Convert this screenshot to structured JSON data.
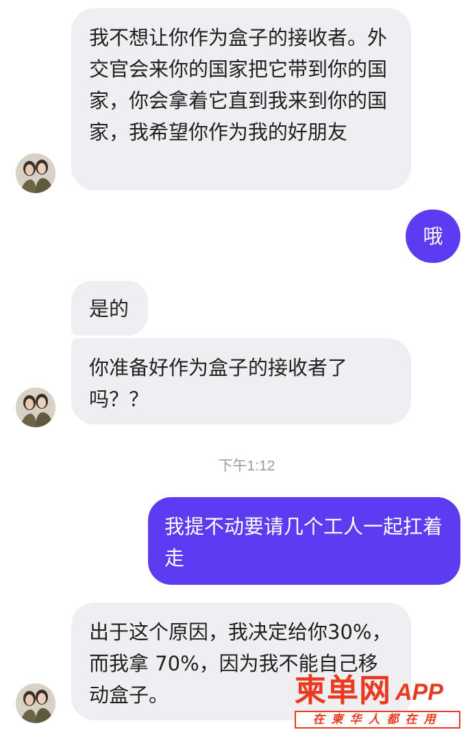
{
  "messages": [
    {
      "side": "incoming",
      "text": "我不想让你作为盒子的接收者。外交官会来你的国家把它带到你的国家，你会拿着它直到我来到你的国家，我希望你作为我的好朋友"
    },
    {
      "side": "outgoing",
      "text": "哦"
    },
    {
      "side": "incoming",
      "text": "是的"
    },
    {
      "side": "incoming",
      "text": "你准备好作为盒子的接收者了吗？？"
    },
    {
      "side": "outgoing",
      "text": "我提不动要请几个工人一起扛着走"
    },
    {
      "side": "incoming",
      "text": "出于这个原因，我决定给你30%，而我拿 70%，因为我不能自己移动盒子。"
    }
  ],
  "timestamp": "下午1:12",
  "watermark": {
    "logo": "柬单网",
    "app": "APP",
    "slogan": "在柬华人都在用"
  },
  "colors": {
    "incoming_bubble": "#efeff1",
    "outgoing_bubble": "#5b3cf0",
    "watermark": "#e83a1f"
  },
  "icons": {
    "avatar": "contact-avatar-photo"
  }
}
